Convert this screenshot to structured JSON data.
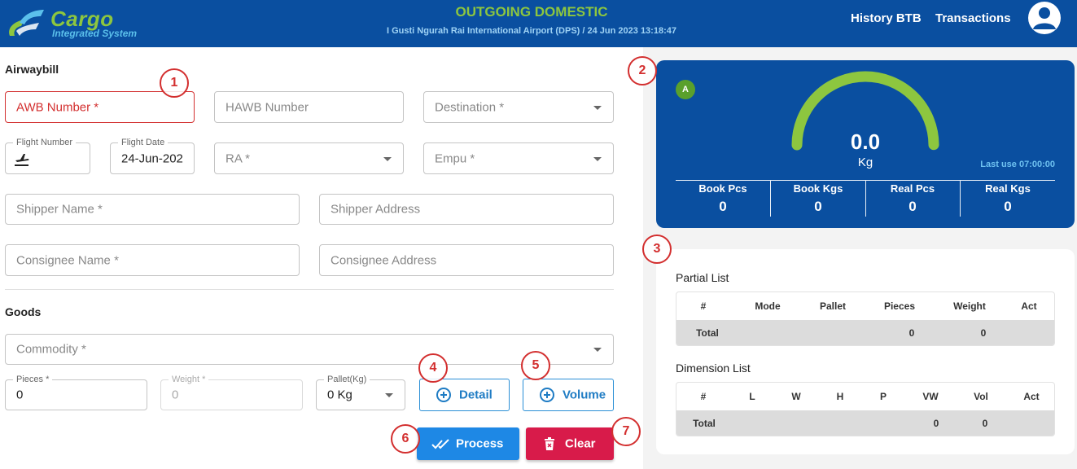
{
  "header": {
    "logo_title": "Cargo",
    "logo_subtitle": "Integrated System",
    "page_title": "OUTGOING DOMESTIC",
    "page_subtitle": "I Gusti Ngurah Rai International Airport (DPS) / 24 Jun 2023 13:18:47",
    "nav": [
      "History BTB",
      "Transactions"
    ],
    "avatar_icon": "user-account-icon"
  },
  "colors": {
    "brand_blue": "#0a4fa0",
    "brand_green": "#8dc63f",
    "error_red": "#d32f2f",
    "process_blue": "#1e88e5",
    "clear_red": "#d81b4a",
    "annotation_red": "#d32f2f"
  },
  "airwaybill": {
    "section_label": "Airwaybill",
    "awb_placeholder": "AWB Number *",
    "hawb_placeholder": "HAWB Number",
    "destination_placeholder": "Destination *",
    "flight_number_label": "Flight Number",
    "flight_number_icon": "plane-departure-icon",
    "flight_date_label": "Flight Date",
    "flight_date_value": "24-Jun-202",
    "ra_placeholder": "RA *",
    "empu_placeholder": "Empu *",
    "shipper_name_placeholder": "Shipper Name *",
    "shipper_address_placeholder": "Shipper Address",
    "consignee_name_placeholder": "Consignee Name *",
    "consignee_address_placeholder": "Consignee Address"
  },
  "goods": {
    "section_label": "Goods",
    "commodity_placeholder": "Commodity *",
    "pieces_label": "Pieces *",
    "pieces_value": "0",
    "weight_label": "Weight *",
    "weight_value": "0",
    "pallet_label": "Pallet(Kg)",
    "pallet_value": "0 Kg",
    "detail_button": "Detail",
    "volume_button": "Volume",
    "process_button": "Process",
    "clear_button": "Clear"
  },
  "scale": {
    "status_chip": "A",
    "gauge_value": "0.0",
    "gauge_unit": "Kg",
    "gauge_fill": 1.0,
    "last_use": "Last use 07:00:00",
    "stats": [
      {
        "label": "Book Pcs",
        "value": "0"
      },
      {
        "label": "Book Kgs",
        "value": "0"
      },
      {
        "label": "Real Pcs",
        "value": "0"
      },
      {
        "label": "Real Kgs",
        "value": "0"
      }
    ]
  },
  "partial_list": {
    "title": "Partial List",
    "columns": [
      "#",
      "Mode",
      "Pallet",
      "Pieces",
      "Weight",
      "Act"
    ],
    "total_label": "Total",
    "total_pieces": "0",
    "total_weight": "0"
  },
  "dimension_list": {
    "title": "Dimension List",
    "columns": [
      "#",
      "L",
      "W",
      "H",
      "P",
      "VW",
      "Vol",
      "Act"
    ],
    "total_label": "Total",
    "total_vw": "0",
    "total_vol": "0"
  },
  "annotations": [
    "1",
    "2",
    "3",
    "4",
    "5",
    "6",
    "7"
  ]
}
